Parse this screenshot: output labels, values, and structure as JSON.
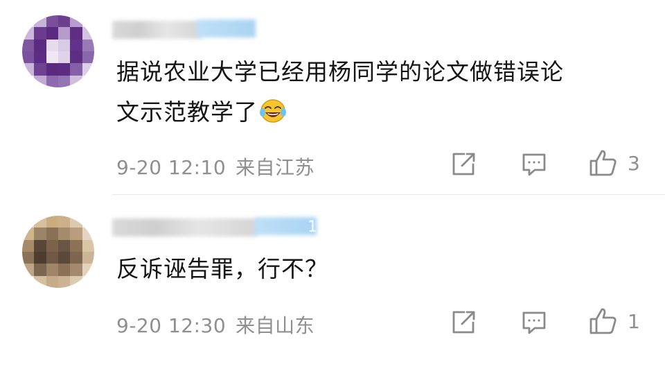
{
  "comments": [
    {
      "text_lines": [
        "据说农业大学已经用杨同学的论文做错误论",
        "文示范教学了"
      ],
      "emoji": "laughing-crying-emoji",
      "date": "9-20 12:10",
      "location": "来自江苏",
      "likes": "3",
      "icons": [
        "share-icon",
        "comment-icon",
        "like-icon"
      ]
    },
    {
      "text_lines": [
        "反诉诬告罪，行不？"
      ],
      "username_badge": "1",
      "date": "9-20 12:30",
      "location": "来自山东",
      "likes": "1",
      "icons": [
        "share-icon",
        "comment-icon",
        "like-icon"
      ]
    }
  ]
}
